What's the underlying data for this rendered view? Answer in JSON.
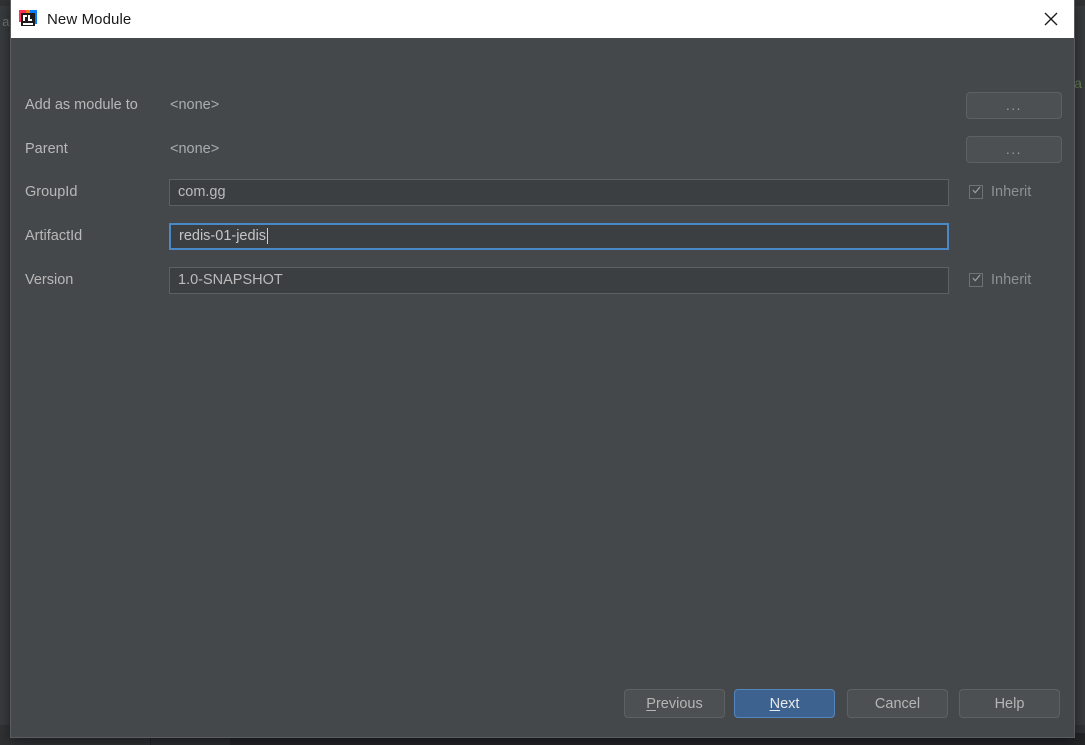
{
  "background": {
    "code_glyph_left": "a",
    "code_glyph_right": "a"
  },
  "dialog": {
    "title": "New Module",
    "icon": "intellij-idea-icon",
    "close_icon": "close-icon",
    "fields": [
      {
        "label": "Add as module to",
        "type": "static",
        "value": "<none>",
        "browse_label": "...",
        "name": "add-as-module-to"
      },
      {
        "label": "Parent",
        "type": "static",
        "value": "<none>",
        "browse_label": "...",
        "name": "parent"
      },
      {
        "label": "GroupId",
        "type": "input",
        "value": "com.gg",
        "placeholder": "",
        "focused": false,
        "inherit_label": "Inherit",
        "inherit_checked": true,
        "name": "group-id"
      },
      {
        "label": "ArtifactId",
        "type": "input",
        "value": "redis-01-jedis",
        "placeholder": "",
        "focused": true,
        "name": "artifact-id"
      },
      {
        "label": "Version",
        "type": "input",
        "value": "1.0-SNAPSHOT",
        "placeholder": "",
        "focused": false,
        "inherit_label": "Inherit",
        "inherit_checked": true,
        "name": "version"
      }
    ],
    "footer": {
      "previous": {
        "prefix": "",
        "mnemonic": "P",
        "suffix": "revious"
      },
      "next": {
        "prefix": "",
        "mnemonic": "N",
        "suffix": "ext"
      },
      "cancel": {
        "label": "Cancel"
      },
      "help": {
        "label": "Help"
      }
    }
  },
  "colors": {
    "dialog_panel": "#45484a",
    "input_bg": "#3c3f41",
    "focus_border": "#4a88c7",
    "default_button": "#3d628f",
    "titlebar_bg": "#ffffff",
    "code_green": "#6a8759"
  }
}
